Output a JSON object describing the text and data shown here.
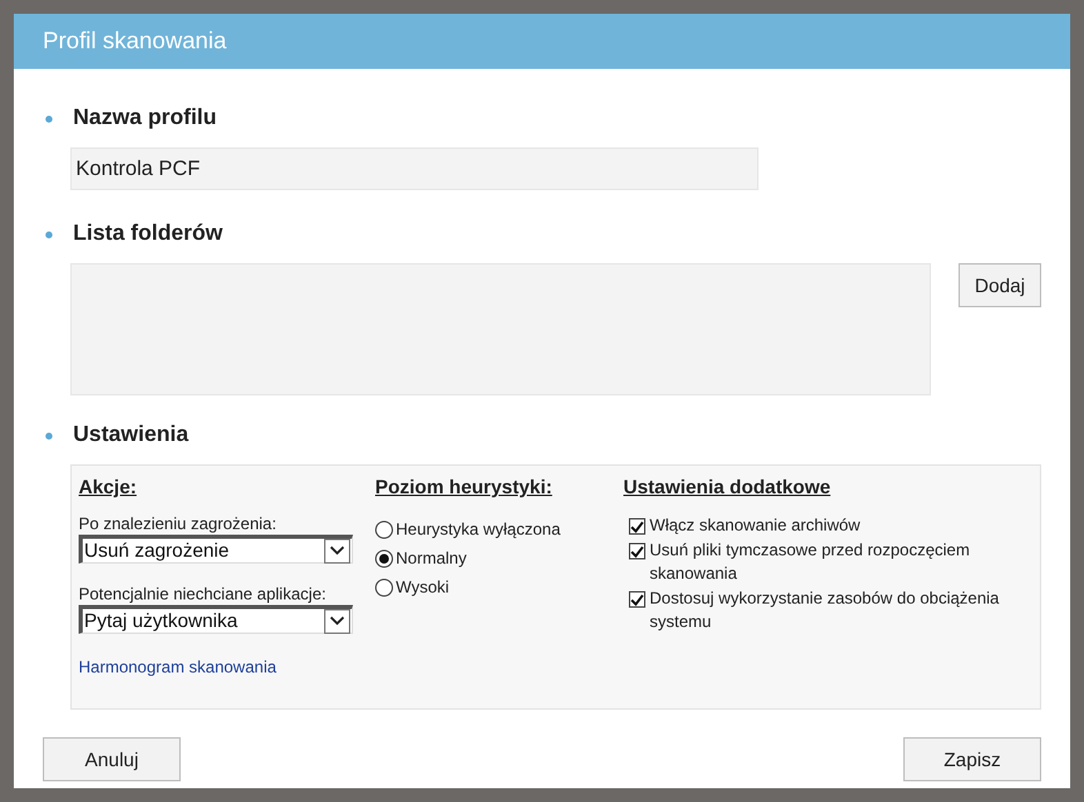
{
  "dialog": {
    "title": "Profil skanowania"
  },
  "profile_name": {
    "heading": "Nazwa profilu",
    "value": "Kontrola PCF"
  },
  "folder_list": {
    "heading": "Lista folderów",
    "add_button": "Dodaj"
  },
  "settings": {
    "heading": "Ustawienia",
    "actions": {
      "heading": "Akcje:",
      "selects": [
        {
          "label": "Po znalezieniu zagrożenia:",
          "value": "Usuń zagrożenie"
        },
        {
          "label": "Potencjalnie niechciane aplikacje:",
          "value": "Pytaj użytkownika"
        }
      ],
      "link": "Harmonogram skanowania"
    },
    "heuristics": {
      "heading": "Poziom heurystyki:",
      "options": [
        {
          "label": "Heurystyka wyłączona",
          "selected": false
        },
        {
          "label": "Normalny",
          "selected": true
        },
        {
          "label": "Wysoki",
          "selected": false
        }
      ]
    },
    "extra": {
      "heading": "Ustawienia dodatkowe",
      "options": [
        {
          "label": "Włącz skanowanie archiwów",
          "checked": true
        },
        {
          "label": "Usuń pliki tymczasowe przed rozpoczęciem skanowania",
          "checked": true
        },
        {
          "label": "Dostosuj wykorzystanie zasobów do obciążenia systemu",
          "checked": true
        }
      ]
    }
  },
  "buttons": {
    "cancel": "Anuluj",
    "save": "Zapisz"
  }
}
